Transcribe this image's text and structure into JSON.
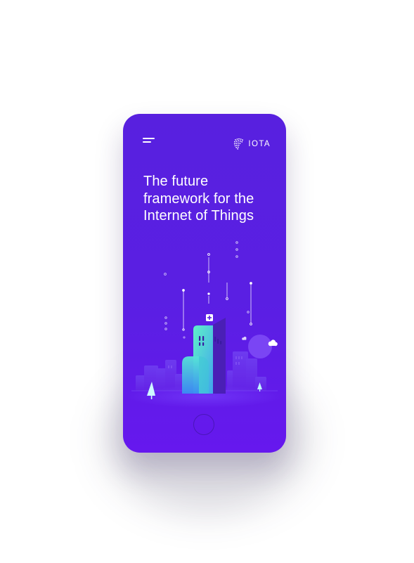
{
  "brand": {
    "logo_text": "IOTA",
    "icon": "iota-dot-logo-icon"
  },
  "nav": {
    "menu_icon": "hamburger-menu-icon"
  },
  "hero": {
    "headline": "The future framework for the Internet of Things"
  },
  "illustration": {
    "icon": "iot-city-illustration"
  },
  "device": {
    "home_button_icon": "home-button-icon"
  },
  "colors": {
    "background": "#ffffff",
    "phone_gradient_top": "#5820df",
    "phone_gradient_bottom": "#6618ee",
    "accent_teal": "#4fe0c9",
    "text": "#ffffff"
  }
}
